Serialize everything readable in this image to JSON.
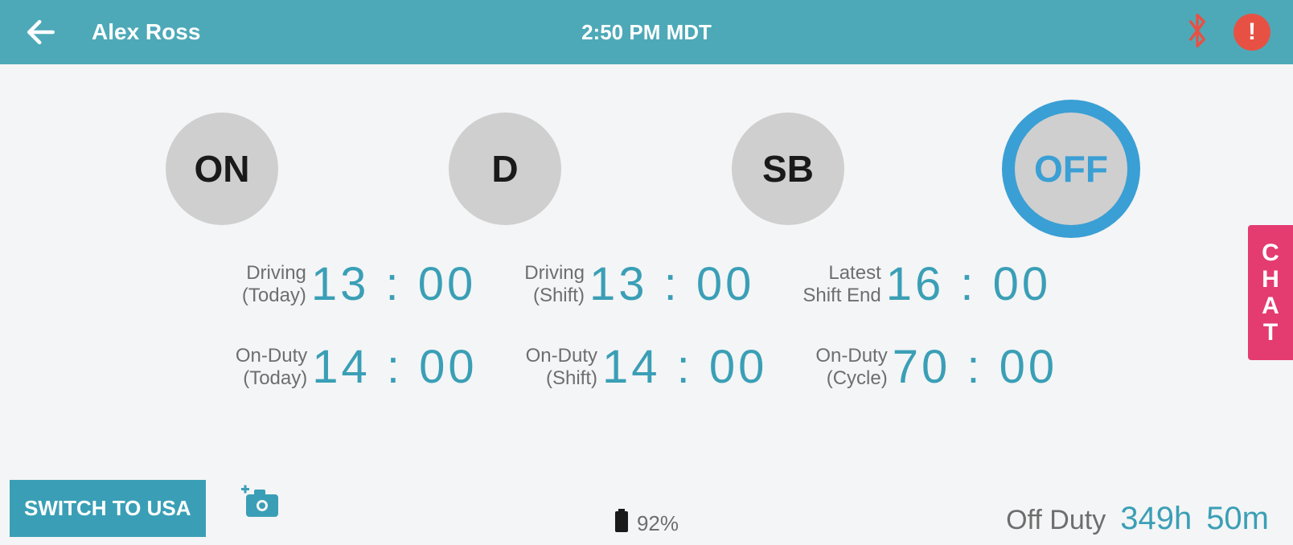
{
  "header": {
    "username": "Alex Ross",
    "time": "2:50 PM MDT",
    "alert_symbol": "!"
  },
  "status_buttons": {
    "on": "ON",
    "d": "D",
    "sb": "SB",
    "off": "OFF"
  },
  "metrics_row1": [
    {
      "label1": "Driving",
      "label2": "(Today)",
      "value": "13 : 00"
    },
    {
      "label1": "Driving",
      "label2": "(Shift)",
      "value": "13 : 00"
    },
    {
      "label1": "Latest",
      "label2": "Shift End",
      "value": "16 : 00"
    }
  ],
  "metrics_row2": [
    {
      "label1": "On-Duty",
      "label2": "(Today)",
      "value": "14 : 00"
    },
    {
      "label1": "On-Duty",
      "label2": "(Shift)",
      "value": "14 : 00"
    },
    {
      "label1": "On-Duty",
      "label2": "(Cycle)",
      "value": "70 : 00"
    }
  ],
  "chat": {
    "c": "C",
    "h": "H",
    "a": "A",
    "t": "T"
  },
  "footer": {
    "switch_label": "SWITCH TO USA",
    "battery_pct": "92%",
    "offduty_label": "Off Duty",
    "offduty_hours": "349h",
    "offduty_mins": "50m"
  }
}
